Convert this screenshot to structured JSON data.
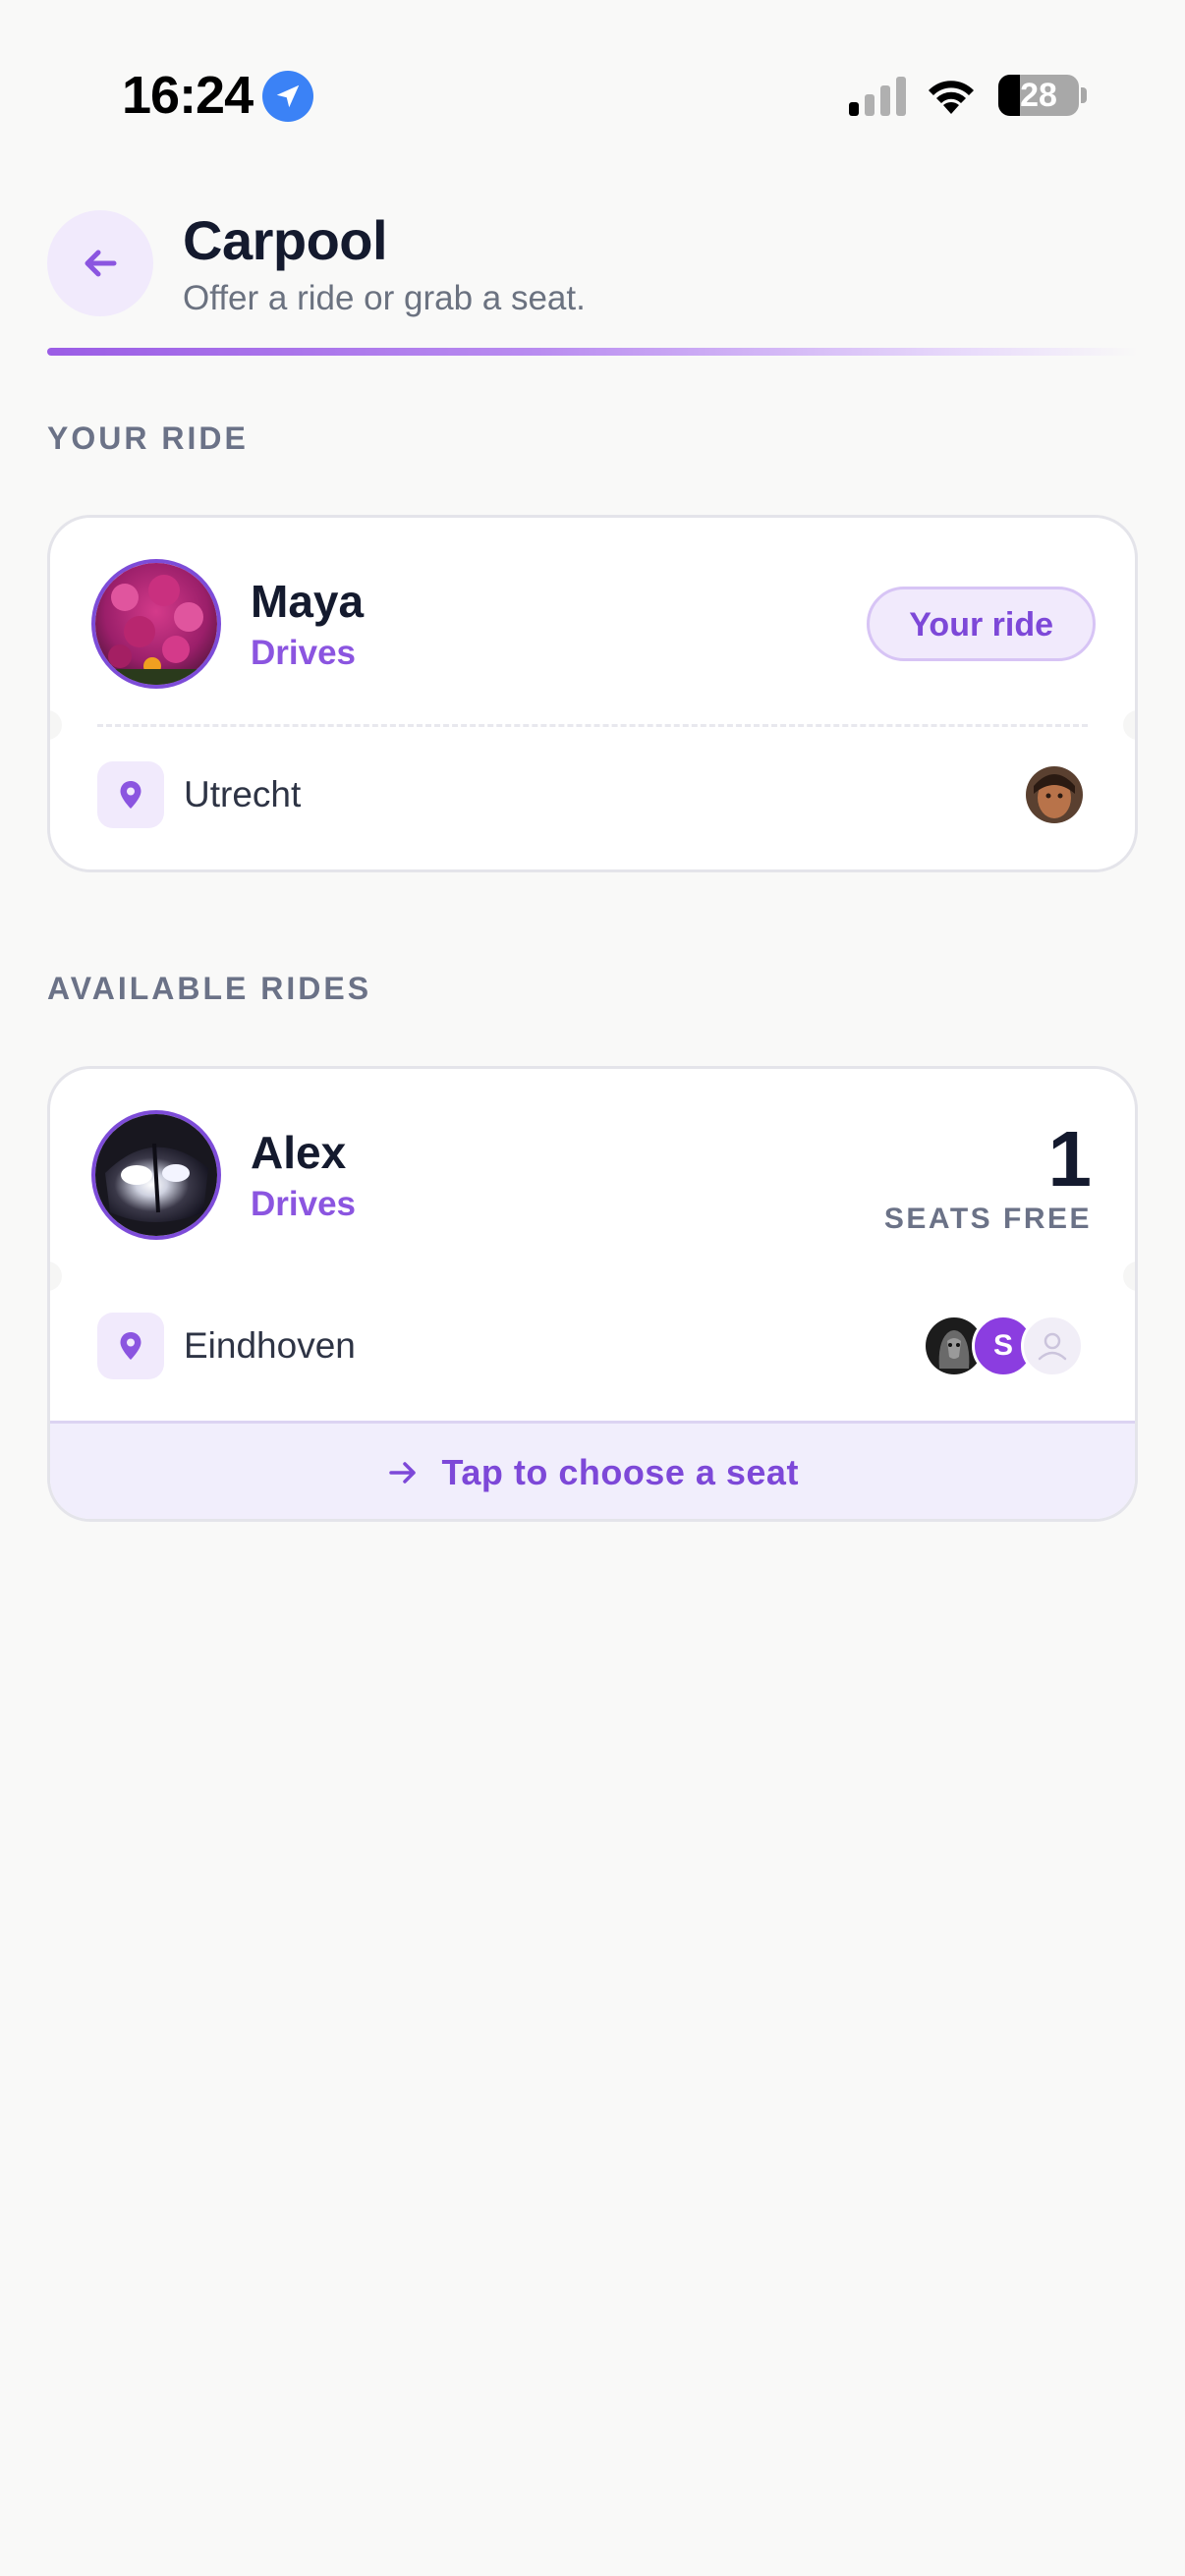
{
  "status_bar": {
    "time": "16:24",
    "battery": "28",
    "icons": [
      "location-arrow-icon",
      "cellular-signal-icon",
      "wifi-icon",
      "battery-icon"
    ]
  },
  "header": {
    "title": "Carpool",
    "subtitle": "Offer a ride or grab a seat.",
    "back_icon": "arrow-left-icon"
  },
  "colors": {
    "accent": "#8b55e0",
    "accent_soft": "#f1eafc",
    "text_dark": "#141a2e",
    "text_muted": "#6b7287",
    "background": "#f9f9f8"
  },
  "your_ride": {
    "section_label": "YOUR RIDE",
    "driver_name": "Maya",
    "driver_role": "Drives",
    "badge": "Your ride",
    "location": "Utrecht",
    "avatar": "flowers-photo-avatar",
    "passengers": [
      "passenger-photo-avatar"
    ]
  },
  "available_rides": {
    "section_label": "AVAILABLE RIDES",
    "rides": [
      {
        "driver_name": "Alex",
        "driver_role": "Drives",
        "seats_free_count": "1",
        "seats_free_label": "SEATS FREE",
        "location": "Eindhoven",
        "avatar": "motorcycle-headlight-photo-avatar",
        "passengers": [
          {
            "type": "photo",
            "initial": ""
          },
          {
            "type": "initial",
            "initial": "S"
          },
          {
            "type": "empty-seat",
            "initial": ""
          }
        ],
        "action_label": "Tap to choose a seat",
        "action_icon": "arrow-right-icon"
      }
    ]
  }
}
